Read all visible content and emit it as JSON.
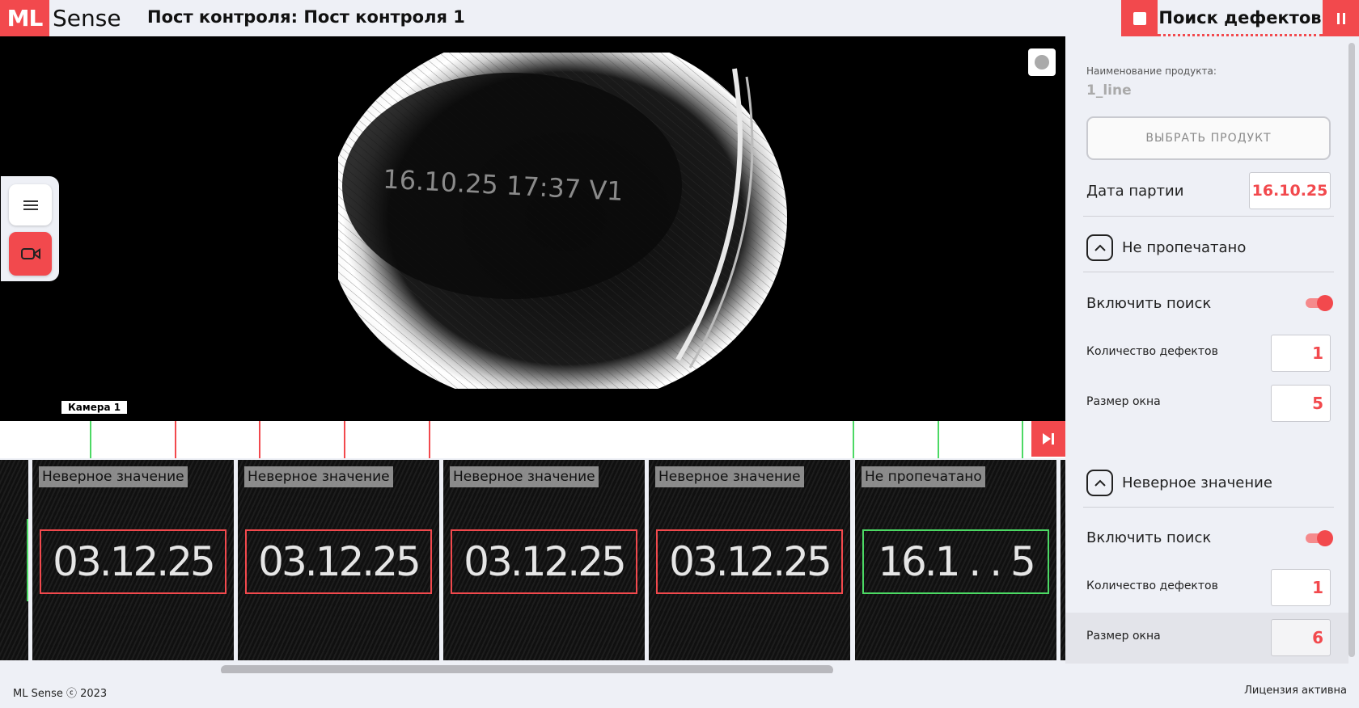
{
  "header": {
    "logo_ml": "ML",
    "logo_sense": "Sense",
    "title": "Пост контроля: Пост контроля 1",
    "mode_title": "Поиск дефектов"
  },
  "camera": {
    "frame_text": "16.10.25 17:37 V1",
    "label": "Камера 1"
  },
  "timeline": {
    "ticks": [
      "ok",
      "defect",
      "defect",
      "defect",
      "defect",
      "ok",
      "ok",
      "ok"
    ]
  },
  "thumbnails": [
    {
      "label": "Неверное значение",
      "text": "03.12.25",
      "status": "defect"
    },
    {
      "label": "Неверное значение",
      "text": "03.12.25",
      "status": "defect"
    },
    {
      "label": "Неверное значение",
      "text": "03.12.25",
      "status": "defect"
    },
    {
      "label": "Неверное значение",
      "text": "03.12.25",
      "status": "defect"
    },
    {
      "label": "Не пропечатано",
      "text": "16.1 . . 5",
      "status": "ok"
    }
  ],
  "panel": {
    "product_label": "Наименование продукта:",
    "product_value": "1_line",
    "select_product": "ВЫБРАТЬ ПРОДУКТ",
    "batch_date_label": "Дата партии",
    "batch_date_value": "16.10.25",
    "sections": [
      {
        "title": "Не пропечатано",
        "enable_label": "Включить поиск",
        "enabled": true,
        "defects_label": "Количество дефектов",
        "defects_value": "1",
        "window_label": "Размер окна",
        "window_value": "5"
      },
      {
        "title": "Неверное значение",
        "enable_label": "Включить поиск",
        "enabled": true,
        "defects_label": "Количество дефектов",
        "defects_value": "1",
        "window_label": "Размер окна",
        "window_value": "6"
      }
    ]
  },
  "footer": {
    "copyright": "ML Sense ⓒ 2023",
    "license": "Лицензия активна"
  },
  "colors": {
    "accent": "#f2494d",
    "ok": "#4cd964",
    "background": "#eef0f6"
  }
}
